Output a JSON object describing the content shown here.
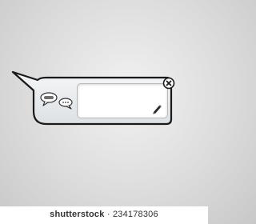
{
  "watermark": {
    "brand": "shutterstock",
    "id": "· 234178306"
  },
  "widget": {
    "icons": [
      "speech-bubble-icon",
      "speech-bubble-small-icon",
      "pencil-icon",
      "close-icon"
    ],
    "colors": {
      "outline": "#1a1a1a",
      "frame": "#e9ecef",
      "panel": "#ffffff",
      "background": "#dcdcdc"
    }
  }
}
